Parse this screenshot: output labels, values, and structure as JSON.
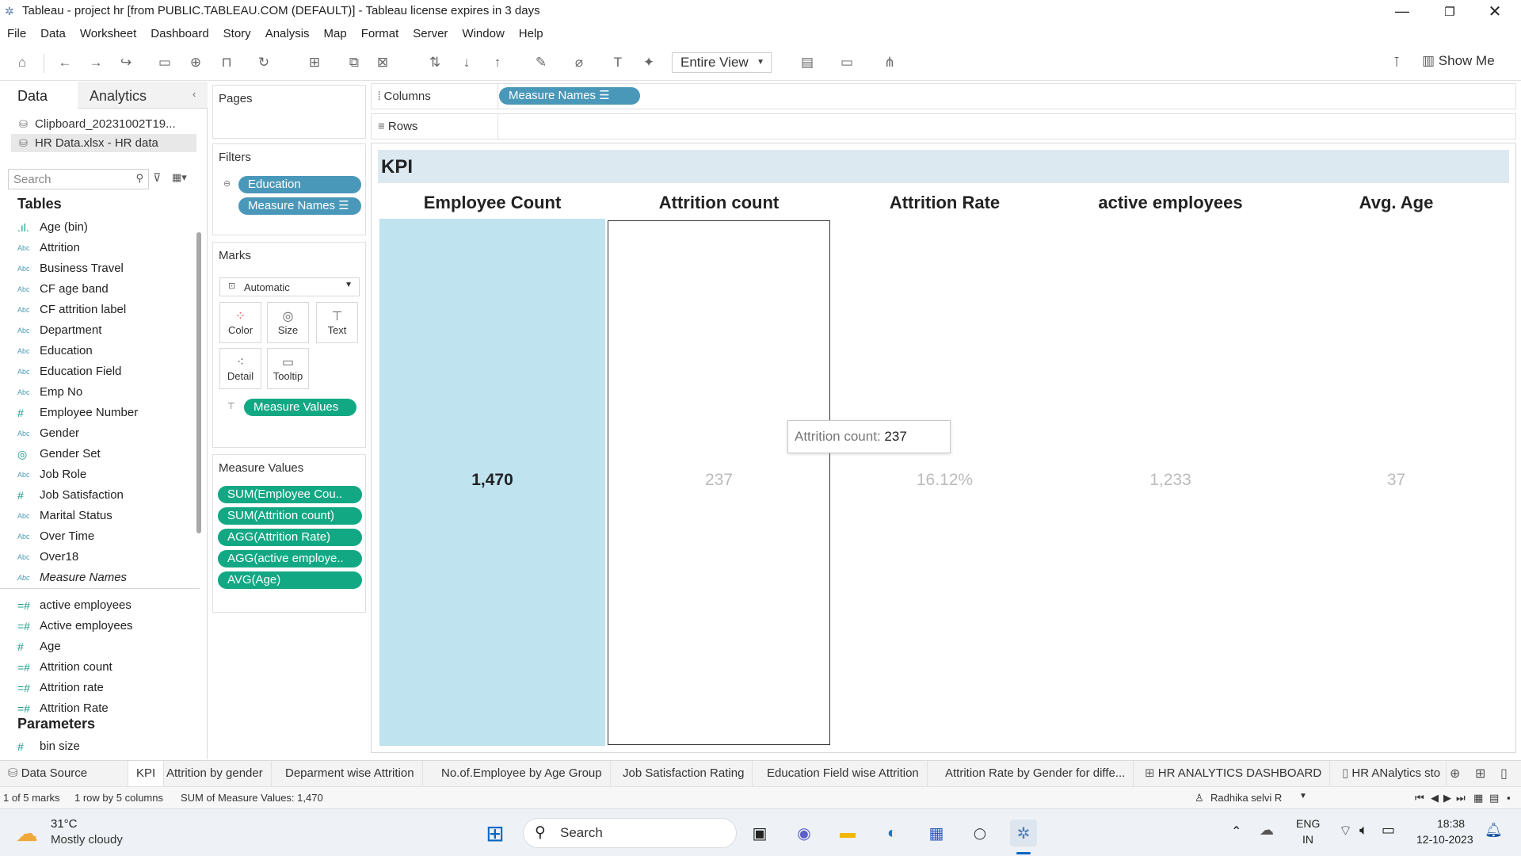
{
  "window": {
    "title": "Tableau - project hr [from PUBLIC.TABLEAU.COM (DEFAULT)] - Tableau license expires in 3 days",
    "app_icon": "tableau-logo-icon"
  },
  "menu": [
    "File",
    "Data",
    "Worksheet",
    "Dashboard",
    "Story",
    "Analysis",
    "Map",
    "Format",
    "Server",
    "Window",
    "Help"
  ],
  "toolbar": {
    "fit": "Entire View",
    "show_me": "Show Me"
  },
  "data_pane": {
    "tab_data": "Data",
    "tab_analytics": "Analytics",
    "datasources": [
      "Clipboard_20231002T19...",
      "HR Data.xlsx - HR data"
    ],
    "search_placeholder": "Search",
    "tables_heading": "Tables",
    "fields": [
      {
        "type": "bin",
        "name": "Age (bin)"
      },
      {
        "type": "Abc",
        "name": "Attrition"
      },
      {
        "type": "Abc",
        "name": "Business Travel"
      },
      {
        "type": "Abc",
        "name": "CF age band"
      },
      {
        "type": "Abc",
        "name": "CF attrition label"
      },
      {
        "type": "Abc",
        "name": "Department"
      },
      {
        "type": "Abc",
        "name": "Education"
      },
      {
        "type": "Abc",
        "name": "Education Field"
      },
      {
        "type": "Abc",
        "name": "Emp No"
      },
      {
        "type": "#",
        "name": "Employee Number"
      },
      {
        "type": "Abc",
        "name": "Gender"
      },
      {
        "type": "set",
        "name": "Gender Set"
      },
      {
        "type": "Abc",
        "name": "Job Role"
      },
      {
        "type": "#",
        "name": "Job Satisfaction"
      },
      {
        "type": "Abc",
        "name": "Marital Status"
      },
      {
        "type": "Abc",
        "name": "Over Time"
      },
      {
        "type": "Abc",
        "name": "Over18"
      },
      {
        "type": "Abc",
        "name": "Measure Names"
      }
    ],
    "measures": [
      {
        "type": "=#",
        "name": "active employees"
      },
      {
        "type": "=#",
        "name": "Active employees"
      },
      {
        "type": "#",
        "name": "Age"
      },
      {
        "type": "=#",
        "name": "Attrition count"
      },
      {
        "type": "=#",
        "name": "Attrition rate"
      },
      {
        "type": "=#",
        "name": "Attrition Rate"
      }
    ],
    "parameters_heading": "Parameters",
    "parameters": [
      {
        "type": "#",
        "name": "bin size"
      }
    ]
  },
  "shelves": {
    "pages": "Pages",
    "filters": "Filters",
    "filter_pills": [
      "Education",
      "Measure Names"
    ],
    "marks": "Marks",
    "mark_type": "Automatic",
    "mark_buttons": [
      "Color",
      "Size",
      "Text",
      "Detail",
      "Tooltip"
    ],
    "marks_pill": "Measure Values",
    "measure_values_heading": "Measure Values",
    "measure_values": [
      "SUM(Employee Cou..",
      "SUM(Attrition count)",
      "AGG(Attrition Rate)",
      "AGG(active employe..",
      "AVG(Age)"
    ],
    "columns_label": "Columns",
    "columns_pill": "Measure Names",
    "rows_label": "Rows"
  },
  "view": {
    "title": "KPI",
    "columns": [
      {
        "header": "Employee Count",
        "value": "1,470"
      },
      {
        "header": "Attrition count",
        "value": "237"
      },
      {
        "header": "Attrition Rate",
        "value": "16.12%"
      },
      {
        "header": "active employees",
        "value": "1,233"
      },
      {
        "header": "Avg. Age",
        "value": "37"
      }
    ],
    "tooltip_label": "Attrition count:",
    "tooltip_value": "237"
  },
  "sheet_tabs": [
    "Data Source",
    "KPI",
    "Attrition by gender",
    "Deparment wise Attrition",
    "No.of.Employee by Age Group",
    "Job Satisfaction Rating",
    "Education Field wise Attrition",
    "Attrition Rate by Gender for diffe...",
    "HR ANALYTICS DASHBOARD",
    "HR ANalytics sto"
  ],
  "status": {
    "marks": "1 of 5 marks",
    "dims": "1 row by 5 columns",
    "sum": "SUM of Measure Values: 1,470",
    "user": "Radhika selvi R"
  },
  "taskbar": {
    "temp": "31°C",
    "weather": "Mostly cloudy",
    "search": "Search",
    "lang1": "ENG",
    "lang2": "IN",
    "time": "18:38",
    "date": "12-10-2023"
  },
  "colors": {
    "pill_blue": "#4a98b9",
    "pill_green": "#13a884",
    "highlight": "#bfe3ef",
    "kpi_header": "#dde9f0"
  }
}
